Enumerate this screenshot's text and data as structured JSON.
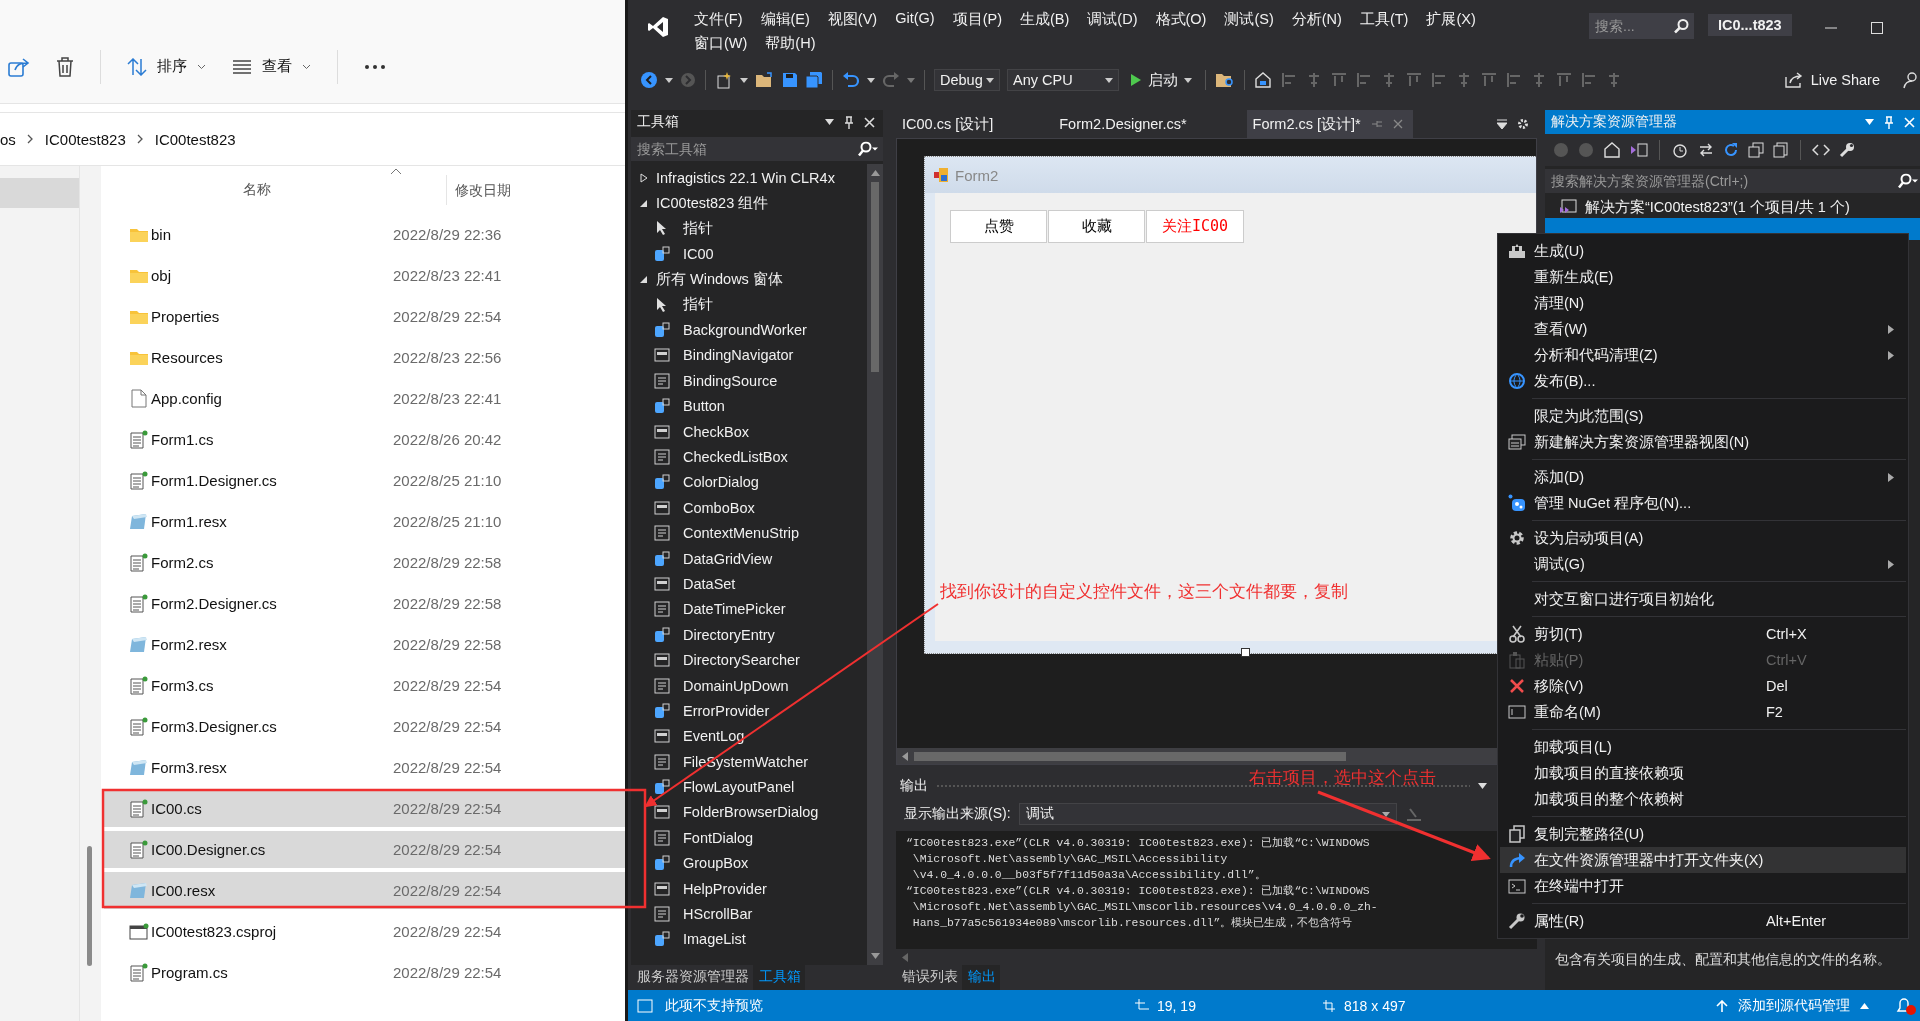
{
  "explorer": {
    "toolbar": [
      {
        "label": "排序"
      },
      {
        "label": "查看"
      }
    ],
    "breadcrumb": [
      "os",
      "IC00test823",
      "IC00test823"
    ],
    "columns": [
      "名称",
      "修改日期"
    ],
    "files": [
      {
        "name": "bin",
        "date": "2022/8/29 22:36",
        "kind": "folder",
        "selected": false
      },
      {
        "name": "obj",
        "date": "2022/8/23 22:41",
        "kind": "folder",
        "selected": false
      },
      {
        "name": "Properties",
        "date": "2022/8/29 22:54",
        "kind": "folder",
        "selected": false
      },
      {
        "name": "Resources",
        "date": "2022/8/23 22:56",
        "kind": "folder",
        "selected": false
      },
      {
        "name": "App.config",
        "date": "2022/8/23 22:41",
        "kind": "config",
        "selected": false
      },
      {
        "name": "Form1.cs",
        "date": "2022/8/26 20:42",
        "kind": "code",
        "selected": false
      },
      {
        "name": "Form1.Designer.cs",
        "date": "2022/8/25 21:10",
        "kind": "code",
        "selected": false
      },
      {
        "name": "Form1.resx",
        "date": "2022/8/25 21:10",
        "kind": "resx",
        "selected": false
      },
      {
        "name": "Form2.cs",
        "date": "2022/8/29 22:58",
        "kind": "code",
        "selected": false
      },
      {
        "name": "Form2.Designer.cs",
        "date": "2022/8/29 22:58",
        "kind": "code",
        "selected": false
      },
      {
        "name": "Form2.resx",
        "date": "2022/8/29 22:58",
        "kind": "resx",
        "selected": false
      },
      {
        "name": "Form3.cs",
        "date": "2022/8/29 22:54",
        "kind": "code",
        "selected": false
      },
      {
        "name": "Form3.Designer.cs",
        "date": "2022/8/29 22:54",
        "kind": "code",
        "selected": false
      },
      {
        "name": "Form3.resx",
        "date": "2022/8/29 22:54",
        "kind": "resx",
        "selected": false
      },
      {
        "name": "IC00.cs",
        "date": "2022/8/29 22:54",
        "kind": "code",
        "selected": true
      },
      {
        "name": "IC00.Designer.cs",
        "date": "2022/8/29 22:54",
        "kind": "code",
        "selected": true
      },
      {
        "name": "IC00.resx",
        "date": "2022/8/29 22:54",
        "kind": "resx",
        "selected": true
      },
      {
        "name": "IC00test823.csproj",
        "date": "2022/8/29 22:54",
        "kind": "project",
        "selected": false
      },
      {
        "name": "Program.cs",
        "date": "2022/8/29 22:54",
        "kind": "code",
        "selected": false
      }
    ]
  },
  "vs": {
    "menu": [
      "文件(F)",
      "编辑(E)",
      "视图(V)",
      "Git(G)",
      "项目(P)",
      "生成(B)",
      "调试(D)",
      "格式(O)",
      "测试(S)",
      "分析(N)",
      "工具(T)",
      "扩展(X)",
      "窗口(W)",
      "帮助(H)"
    ],
    "search": {
      "placeholder": "搜索..."
    },
    "title": "IC0...t823",
    "toolbar": {
      "configuration": "Debug",
      "platform": "Any CPU",
      "start": "启动",
      "live_share": "Live Share"
    },
    "toolbox": {
      "title": "工具箱",
      "search": {
        "placeholder": "搜索工具箱"
      },
      "groups": [
        {
          "label": "Infragistics 22.1 Win CLR4x",
          "expanded": false
        },
        {
          "label": "IC00test823 组件",
          "expanded": true,
          "items": [
            {
              "label": "指针",
              "kind": "pointer"
            },
            {
              "label": "IC00",
              "kind": "control"
            }
          ]
        },
        {
          "label": "所有 Windows 窗体",
          "expanded": true,
          "items": [
            {
              "label": "指针",
              "kind": "pointer"
            },
            {
              "label": "BackgroundWorker",
              "kind": "control"
            },
            {
              "label": "BindingNavigator",
              "kind": "control"
            },
            {
              "label": "BindingSource",
              "kind": "control"
            },
            {
              "label": "Button",
              "kind": "control"
            },
            {
              "label": "CheckBox",
              "kind": "control"
            },
            {
              "label": "CheckedListBox",
              "kind": "control"
            },
            {
              "label": "ColorDialog",
              "kind": "control"
            },
            {
              "label": "ComboBox",
              "kind": "control"
            },
            {
              "label": "ContextMenuStrip",
              "kind": "control"
            },
            {
              "label": "DataGridView",
              "kind": "control"
            },
            {
              "label": "DataSet",
              "kind": "control"
            },
            {
              "label": "DateTimePicker",
              "kind": "control"
            },
            {
              "label": "DirectoryEntry",
              "kind": "control"
            },
            {
              "label": "DirectorySearcher",
              "kind": "control"
            },
            {
              "label": "DomainUpDown",
              "kind": "control"
            },
            {
              "label": "ErrorProvider",
              "kind": "control"
            },
            {
              "label": "EventLog",
              "kind": "control"
            },
            {
              "label": "FileSystemWatcher",
              "kind": "control"
            },
            {
              "label": "FlowLayoutPanel",
              "kind": "control"
            },
            {
              "label": "FolderBrowserDialog",
              "kind": "control"
            },
            {
              "label": "FontDialog",
              "kind": "control"
            },
            {
              "label": "GroupBox",
              "kind": "control"
            },
            {
              "label": "HelpProvider",
              "kind": "control"
            },
            {
              "label": "HScrollBar",
              "kind": "control"
            },
            {
              "label": "ImageList",
              "kind": "control"
            }
          ]
        }
      ],
      "tabs": [
        {
          "label": "服务器资源管理器",
          "selected": false
        },
        {
          "label": "工具箱",
          "selected": true
        }
      ]
    },
    "doc_tabs": [
      {
        "label": "IC00.cs [设计]",
        "selected": false
      },
      {
        "label": "Form2.Designer.cs*",
        "selected": false
      },
      {
        "label": "Form2.cs [设计]*",
        "selected": true
      }
    ],
    "form": {
      "title": "Form2",
      "buttons": [
        {
          "label": "点赞",
          "color": "#000000"
        },
        {
          "label": "收藏",
          "color": "#000000"
        },
        {
          "label": "关注IC00",
          "color": "#ff0000"
        }
      ]
    },
    "output": {
      "title": "输出",
      "source_label": "显示输出来源(S):",
      "source": "调试",
      "lines": [
        "“IC00test823.exe”(CLR v4.0.30319: IC00test823.exe): 已加载“C:\\WINDOWS",
        " \\Microsoft.Net\\assembly\\GAC_MSIL\\Accessibility",
        " \\v4.0_4.0.0.0__b03f5f7f11d50a3a\\Accessibility.dll”。",
        "“IC00test823.exe”(CLR v4.0.30319: IC00test823.exe): 已加载“C:\\WINDOWS",
        " \\Microsoft.Net\\assembly\\GAC_MSIL\\mscorlib.resources\\v4.0_4.0.0.0_zh-",
        " Hans_b77a5c561934e089\\mscorlib.resources.dll”。模块已生成，不包含符号"
      ],
      "tabs": [
        {
          "label": "错误列表",
          "selected": false
        },
        {
          "label": "输出",
          "selected": true
        }
      ]
    },
    "solution": {
      "title": "解决方案资源管理器",
      "search": {
        "placeholder": "搜索解决方案资源管理器(Ctrl+;)"
      },
      "root": "解决方案“IC00test823”(1 个项目/共 1 个)",
      "description": "包含有关项目的生成、配置和其他信息的文件的名称。"
    },
    "context_menu": [
      [
        {
          "label": "生成(U)",
          "submenu": false,
          "disabled": false,
          "selected": false
        },
        {
          "label": "重新生成(E)",
          "submenu": false,
          "disabled": false,
          "selected": false
        },
        {
          "label": "清理(N)",
          "submenu": false,
          "disabled": false,
          "selected": false
        },
        {
          "label": "查看(W)",
          "submenu": true,
          "disabled": false,
          "selected": false
        },
        {
          "label": "分析和代码清理(Z)",
          "submenu": true,
          "disabled": false,
          "selected": false
        },
        {
          "label": "发布(B)...",
          "submenu": false,
          "disabled": false,
          "selected": false
        }
      ],
      [
        {
          "label": "限定为此范围(S)",
          "submenu": false,
          "disabled": false,
          "selected": false
        },
        {
          "label": "新建解决方案资源管理器视图(N)",
          "submenu": false,
          "disabled": false,
          "selected": false
        }
      ],
      [
        {
          "label": "添加(D)",
          "submenu": true,
          "disabled": false,
          "selected": false
        },
        {
          "label": "管理 NuGet 程序包(N)...",
          "submenu": false,
          "disabled": false,
          "selected": false
        }
      ],
      [
        {
          "label": "设为启动项目(A)",
          "submenu": false,
          "disabled": false,
          "selected": false
        },
        {
          "label": "调试(G)",
          "submenu": true,
          "disabled": false,
          "selected": false
        }
      ],
      [
        {
          "label": "对交互窗口进行项目初始化",
          "submenu": false,
          "disabled": false,
          "selected": false
        }
      ],
      [
        {
          "label": "剪切(T)",
          "shortcut": "Ctrl+X",
          "submenu": false,
          "disabled": false,
          "selected": false
        },
        {
          "label": "粘贴(P)",
          "shortcut": "Ctrl+V",
          "submenu": false,
          "disabled": true,
          "selected": false
        },
        {
          "label": "移除(V)",
          "shortcut": "Del",
          "submenu": false,
          "disabled": false,
          "selected": false
        },
        {
          "label": "重命名(M)",
          "shortcut": "F2",
          "submenu": false,
          "disabled": false,
          "selected": false
        }
      ],
      [
        {
          "label": "卸载项目(L)",
          "submenu": false,
          "disabled": false,
          "selected": false
        },
        {
          "label": "加载项目的直接依赖项",
          "submenu": false,
          "disabled": false,
          "selected": false
        },
        {
          "label": "加载项目的整个依赖树",
          "submenu": false,
          "disabled": false,
          "selected": false
        }
      ],
      [
        {
          "label": "复制完整路径(U)",
          "submenu": false,
          "disabled": false,
          "selected": false
        },
        {
          "label": "在文件资源管理器中打开文件夹(X)",
          "submenu": false,
          "disabled": false,
          "selected": true
        },
        {
          "label": "在终端中打开",
          "submenu": false,
          "disabled": false,
          "selected": false
        }
      ],
      [
        {
          "label": "属性(R)",
          "shortcut": "Alt+Enter",
          "submenu": false,
          "disabled": false,
          "selected": false
        }
      ]
    ],
    "status_bar": {
      "message": "此项不支持预览",
      "position": "19, 19",
      "size": "818 x 497",
      "source_control": "添加到源代码管理"
    }
  },
  "annotations": [
    {
      "text": "找到你设计的自定义控件文件，这三个文件都要，复制"
    },
    {
      "text": "右击项目，选中这个点击"
    }
  ]
}
